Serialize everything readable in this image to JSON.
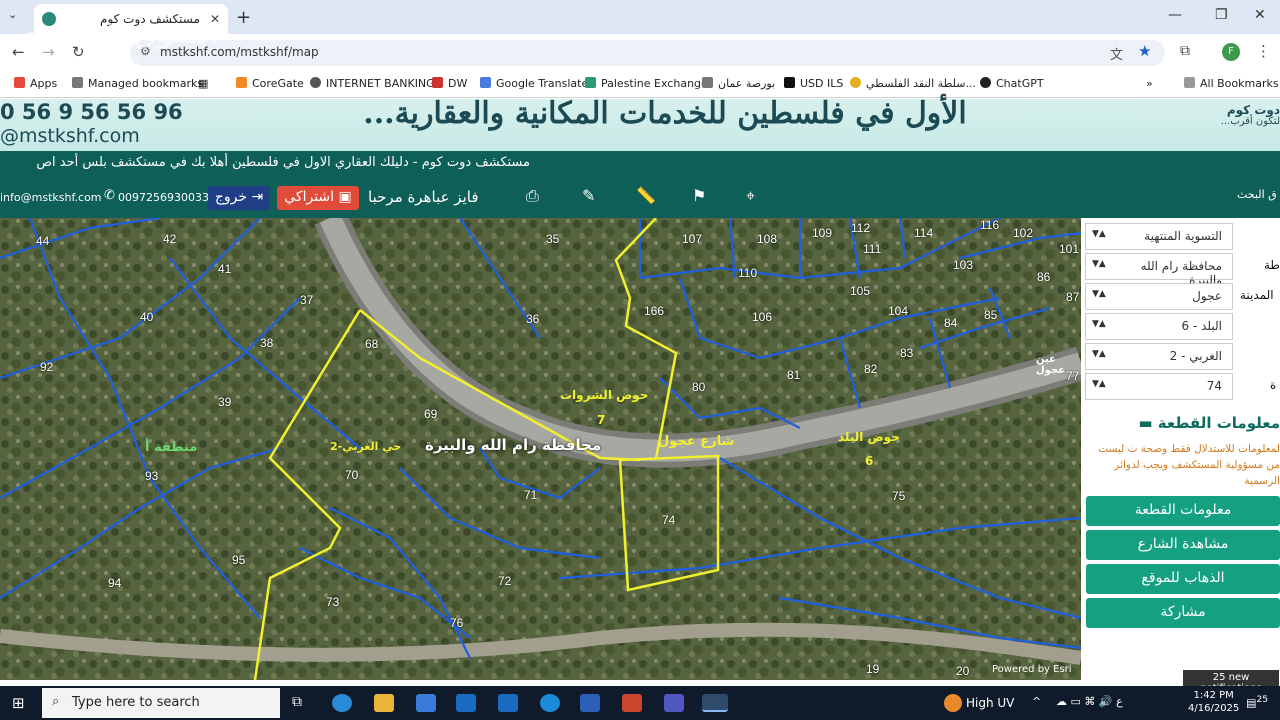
{
  "browser": {
    "tab_title": "مستكشف دوت كوم",
    "url": "mstkshf.com/mstkshf/map",
    "bookmarks": [
      "Apps",
      "Managed bookmarks",
      "CoreGate",
      "INTERNET BANKING",
      "DW",
      "Google Translate",
      "Palestine Exchange",
      "بورصة عمان",
      "USD ILS",
      "سلطة النقد الفلسطي...",
      "ChatGPT",
      "All Bookmarks"
    ]
  },
  "watermark": {
    "arabic": "السوق المفتوح",
    "latin": "opensooq"
  },
  "banner": {
    "headline": "الأول في فلسطين للخدمات المكانية والعقارية...",
    "phone": "0 56 9 56 56 96",
    "site": "@mstkshf.com",
    "logo_text": "دوت كوم",
    "logo_tagline": "لتكون أقرب..."
  },
  "ticker": "مستكشف دوت كوم - دليلك العقاري الاول في فلسطين     أهلا بك في مستكشف بلس أحد اص",
  "nav": {
    "email": "info@mstkshf.com",
    "phone": "00972569300333",
    "logout": "خروج",
    "subscribe": "اشتراكي",
    "greeting": "فايز عباهرة مرحبا",
    "search_label": "ق البحث"
  },
  "panel": {
    "selects": [
      "التسوية المنتهية",
      "محافظة رام الله والبيرة",
      "عجول",
      "البلد - 6",
      "الغربي - 2",
      "74"
    ],
    "labels": [
      "طة",
      "المدينة",
      "ة"
    ],
    "info_title": "معلومات القطعة",
    "note": "لمعلومات للاستدلال فقط وصحة ت ليست من مسؤولية المستكشف ويجب لدوائر الرسمية",
    "buttons": [
      "معلومات القطعة",
      "مشاهدة الشارع",
      "الذهاب للموقع",
      "مشاركة"
    ],
    "notification": "25 new notifications"
  },
  "map": {
    "labels": [
      "محافظة رام الله والبيرة",
      "حوض الشروات",
      "7",
      "شارع عجول",
      "حوض البلد",
      "6",
      "حي الغربي-2",
      "منطقة أ",
      "عين عجول"
    ],
    "plots": [
      "44",
      "42",
      "41",
      "35",
      "107",
      "108",
      "109",
      "112",
      "111",
      "114",
      "116",
      "102",
      "101",
      "103",
      "86",
      "87",
      "110",
      "166",
      "105",
      "104",
      "84",
      "85",
      "37",
      "36",
      "106",
      "38",
      "68",
      "83",
      "40",
      "92",
      "39",
      "80",
      "81",
      "82",
      "77",
      "69",
      "70",
      "93",
      "71",
      "74",
      "75",
      "95",
      "94",
      "72",
      "73",
      "76",
      "20",
      "19"
    ],
    "credit": "Powered by Esri"
  },
  "taskbar": {
    "search_placeholder": "Type here to search",
    "weather": "High UV",
    "time": "1:42 PM",
    "date": "4/16/2025",
    "badge": "25"
  }
}
